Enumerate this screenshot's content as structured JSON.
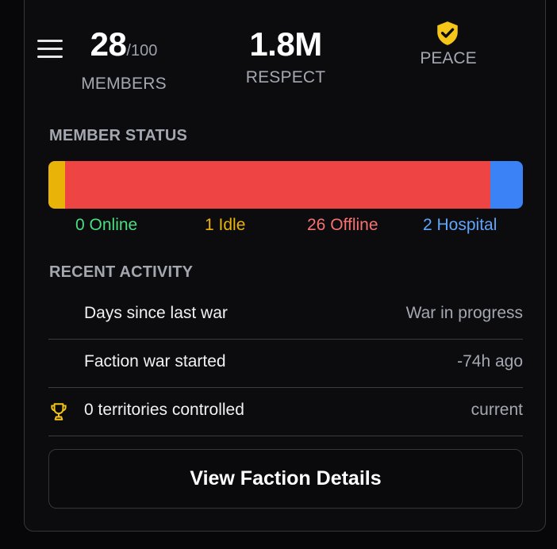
{
  "header": {
    "members": {
      "count": "28",
      "max": "/100",
      "label": "MEMBERS"
    },
    "respect": {
      "value": "1.8M",
      "label": "RESPECT"
    },
    "status": {
      "label": "PEACE",
      "icon": "shield-check-icon",
      "color": "#f5c518"
    }
  },
  "member_status": {
    "title": "MEMBER STATUS",
    "segments": [
      {
        "name": "online",
        "count": 0,
        "label": "0 Online",
        "color": "#4ade80"
      },
      {
        "name": "idle",
        "count": 1,
        "label": "1 Idle",
        "color": "#eab308"
      },
      {
        "name": "offline",
        "count": 26,
        "label": "26 Offline",
        "color": "#ef4444"
      },
      {
        "name": "hospital",
        "count": 2,
        "label": "2 Hospital",
        "color": "#3b82f6"
      }
    ],
    "legend_colors": {
      "online": "#4ade80",
      "idle": "#eab308",
      "offline": "#f87171",
      "hospital": "#60a5fa"
    }
  },
  "recent_activity": {
    "title": "RECENT ACTIVITY",
    "rows": [
      {
        "label": "Days since last war",
        "value": "War in progress",
        "icon": ""
      },
      {
        "label": "Faction war started",
        "value": "-74h ago",
        "icon": ""
      },
      {
        "label": "0 territories controlled",
        "value": "current",
        "icon": "trophy-icon"
      }
    ]
  },
  "actions": {
    "view_details_label": "View Faction Details"
  },
  "colors": {
    "accent_yellow": "#f5c518",
    "background": "#07070a"
  }
}
